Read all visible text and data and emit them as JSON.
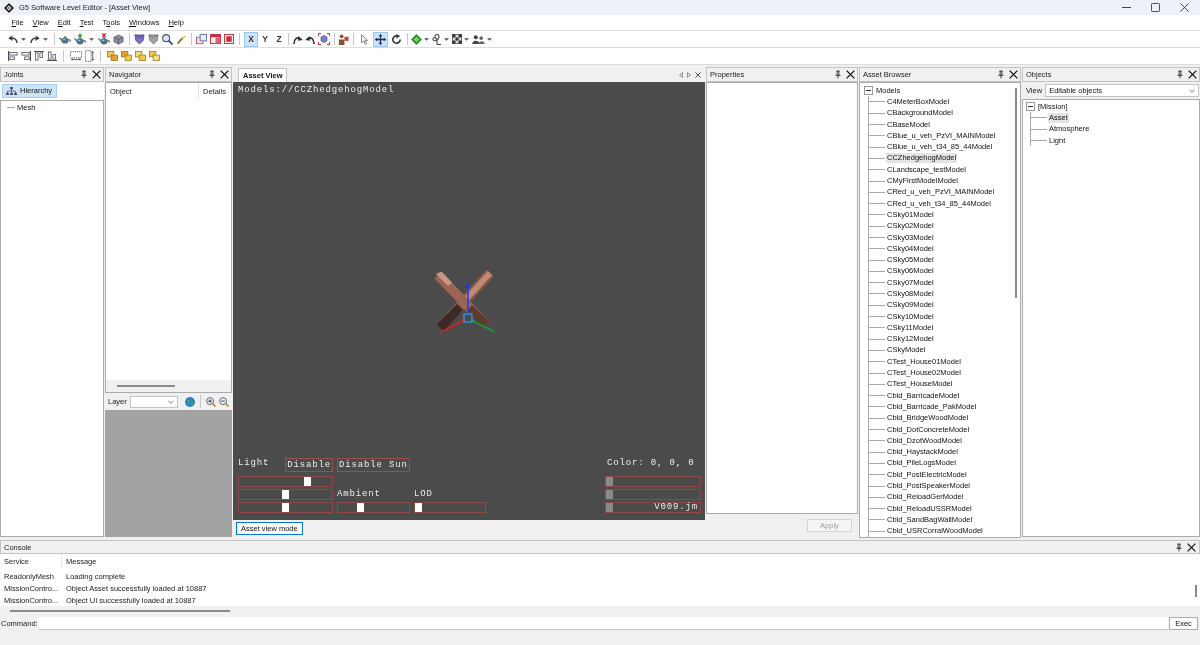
{
  "window": {
    "title": "G5 Software Level Editor - [Asset View]"
  },
  "menu": [
    {
      "key": "F",
      "after": "ile"
    },
    {
      "key": "V",
      "after": "iew"
    },
    {
      "key": "E",
      "after": "dit"
    },
    {
      "key": "T",
      "after": "est"
    },
    {
      "before": "T",
      "key": "o",
      "after": "ols"
    },
    {
      "key": "W",
      "after": "indows"
    },
    {
      "key": "H",
      "after": "elp"
    }
  ],
  "toolbar": {
    "axes": [
      {
        "label": "X",
        "selected": true
      },
      {
        "label": "Y",
        "selected": false
      },
      {
        "label": "Z",
        "selected": false
      }
    ],
    "transform_tools": [
      {
        "selected": false
      },
      {
        "selected": true
      },
      {
        "selected": false
      }
    ]
  },
  "joints": {
    "title": "Joints",
    "hierarchy_button": {
      "label": "Hierarchy",
      "selected": true
    },
    "tree": [
      {
        "label": "Mesh",
        "selected": false
      }
    ]
  },
  "navigator": {
    "title": "Navigator",
    "columns": [
      "Object",
      "Details"
    ],
    "layer_label": "Layer"
  },
  "asset_view": {
    "tab": {
      "label": "Asset View",
      "selected": true
    },
    "viewport": {
      "path": "Models://CCZhedgehogModel",
      "light_label": "Light",
      "buttons": [
        "Disable",
        "Disable Sun"
      ],
      "color_reading": "Color: 0, 0, 0",
      "light_sliders": [
        {
          "level": 0.75
        },
        {
          "level": 0.5
        },
        {
          "level": 0.5
        }
      ],
      "ambient": {
        "label": "Ambient",
        "level": 0.3
      },
      "lod": {
        "label": "LOD",
        "level": 0
      },
      "color_sliders": [
        {
          "level": 0,
          "disabled": true
        },
        {
          "level": 0,
          "disabled": true
        },
        {
          "level": 0,
          "disabled": true,
          "value": "V009.jm"
        }
      ]
    },
    "mode_button": "Asset view mode"
  },
  "properties": {
    "title": "Properties",
    "apply_button": {
      "label": "Apply",
      "disabled": true
    }
  },
  "asset_browser": {
    "title": "Asset Browser",
    "tree": [
      {
        "label": "Models",
        "expanded": true,
        "selected": false,
        "children": [
          {
            "label": "C4MeterBoxModel",
            "selected": false
          },
          {
            "label": "CBackgroundModel",
            "selected": false
          },
          {
            "label": "CBaseModel",
            "selected": false
          },
          {
            "label": "CBlue_u_veh_PzVI_MAINModel",
            "selected": false
          },
          {
            "label": "CBlue_u_veh_t34_85_44Model",
            "selected": false
          },
          {
            "label": "CCZhedgehogModel",
            "selected": true
          },
          {
            "label": "CLandscape_testModel",
            "selected": false
          },
          {
            "label": "CMyFirstModelModel",
            "selected": false
          },
          {
            "label": "CRed_u_veh_PzVI_MAINModel",
            "selected": false
          },
          {
            "label": "CRed_u_veh_t34_85_44Model",
            "selected": false
          },
          {
            "label": "CSky01Model",
            "selected": false
          },
          {
            "label": "CSky02Model",
            "selected": false
          },
          {
            "label": "CSky03Model",
            "selected": false
          },
          {
            "label": "CSky04Model",
            "selected": false
          },
          {
            "label": "CSky05Model",
            "selected": false
          },
          {
            "label": "CSky06Model",
            "selected": false
          },
          {
            "label": "CSky07Model",
            "selected": false
          },
          {
            "label": "CSky08Model",
            "selected": false
          },
          {
            "label": "CSky09Model",
            "selected": false
          },
          {
            "label": "CSky10Model",
            "selected": false
          },
          {
            "label": "CSky11Model",
            "selected": false
          },
          {
            "label": "CSky12Model",
            "selected": false
          },
          {
            "label": "CSkyModel",
            "selected": false
          },
          {
            "label": "CTest_House01Model",
            "selected": false
          },
          {
            "label": "CTest_House02Model",
            "selected": false
          },
          {
            "label": "CTest_HouseModel",
            "selected": false
          },
          {
            "label": "Cbld_BarricadeModel",
            "selected": false
          },
          {
            "label": "Cbld_Barricade_PakModel",
            "selected": false
          },
          {
            "label": "Cbld_BridgeWoodModel",
            "selected": false
          },
          {
            "label": "Cbld_DotConcreteModel",
            "selected": false
          },
          {
            "label": "Cbld_DzotWoodModel",
            "selected": false
          },
          {
            "label": "Cbld_HaystackModel",
            "selected": false
          },
          {
            "label": "Cbld_PileLogsModel",
            "selected": false
          },
          {
            "label": "Cbld_PostElectricModel",
            "selected": false
          },
          {
            "label": "Cbld_PostSpeakerModel",
            "selected": false
          },
          {
            "label": "Cbld_ReloadGerModel",
            "selected": false
          },
          {
            "label": "Cbld_ReloadUSSRModel",
            "selected": false
          },
          {
            "label": "Cbld_SandBagWallModel",
            "selected": false
          },
          {
            "label": "Cbld_USRCorralWoodModel",
            "selected": false
          }
        ]
      }
    ]
  },
  "objects": {
    "title": "Objects",
    "view_label": "View",
    "view_value": "Editable objects",
    "tree": [
      {
        "label": "[Mission]",
        "expanded": true,
        "selected": false,
        "children": [
          {
            "label": "Asset",
            "selected": true
          },
          {
            "label": "Atmosphere",
            "selected": false
          },
          {
            "label": "Light",
            "selected": false
          }
        ]
      }
    ]
  },
  "console": {
    "title": "Console",
    "columns": [
      "Service",
      "Message"
    ],
    "rows": [
      {
        "service": "ReadonlyMesh",
        "message": "Loading complete"
      },
      {
        "service": "MissionContro...",
        "message": "Object Asset successfully loaded at 10887"
      },
      {
        "service": "MissionContro...",
        "message": "Object UI successfully loaded at 10887"
      }
    ],
    "command_label": "Command:",
    "exec_button": "Exec"
  }
}
